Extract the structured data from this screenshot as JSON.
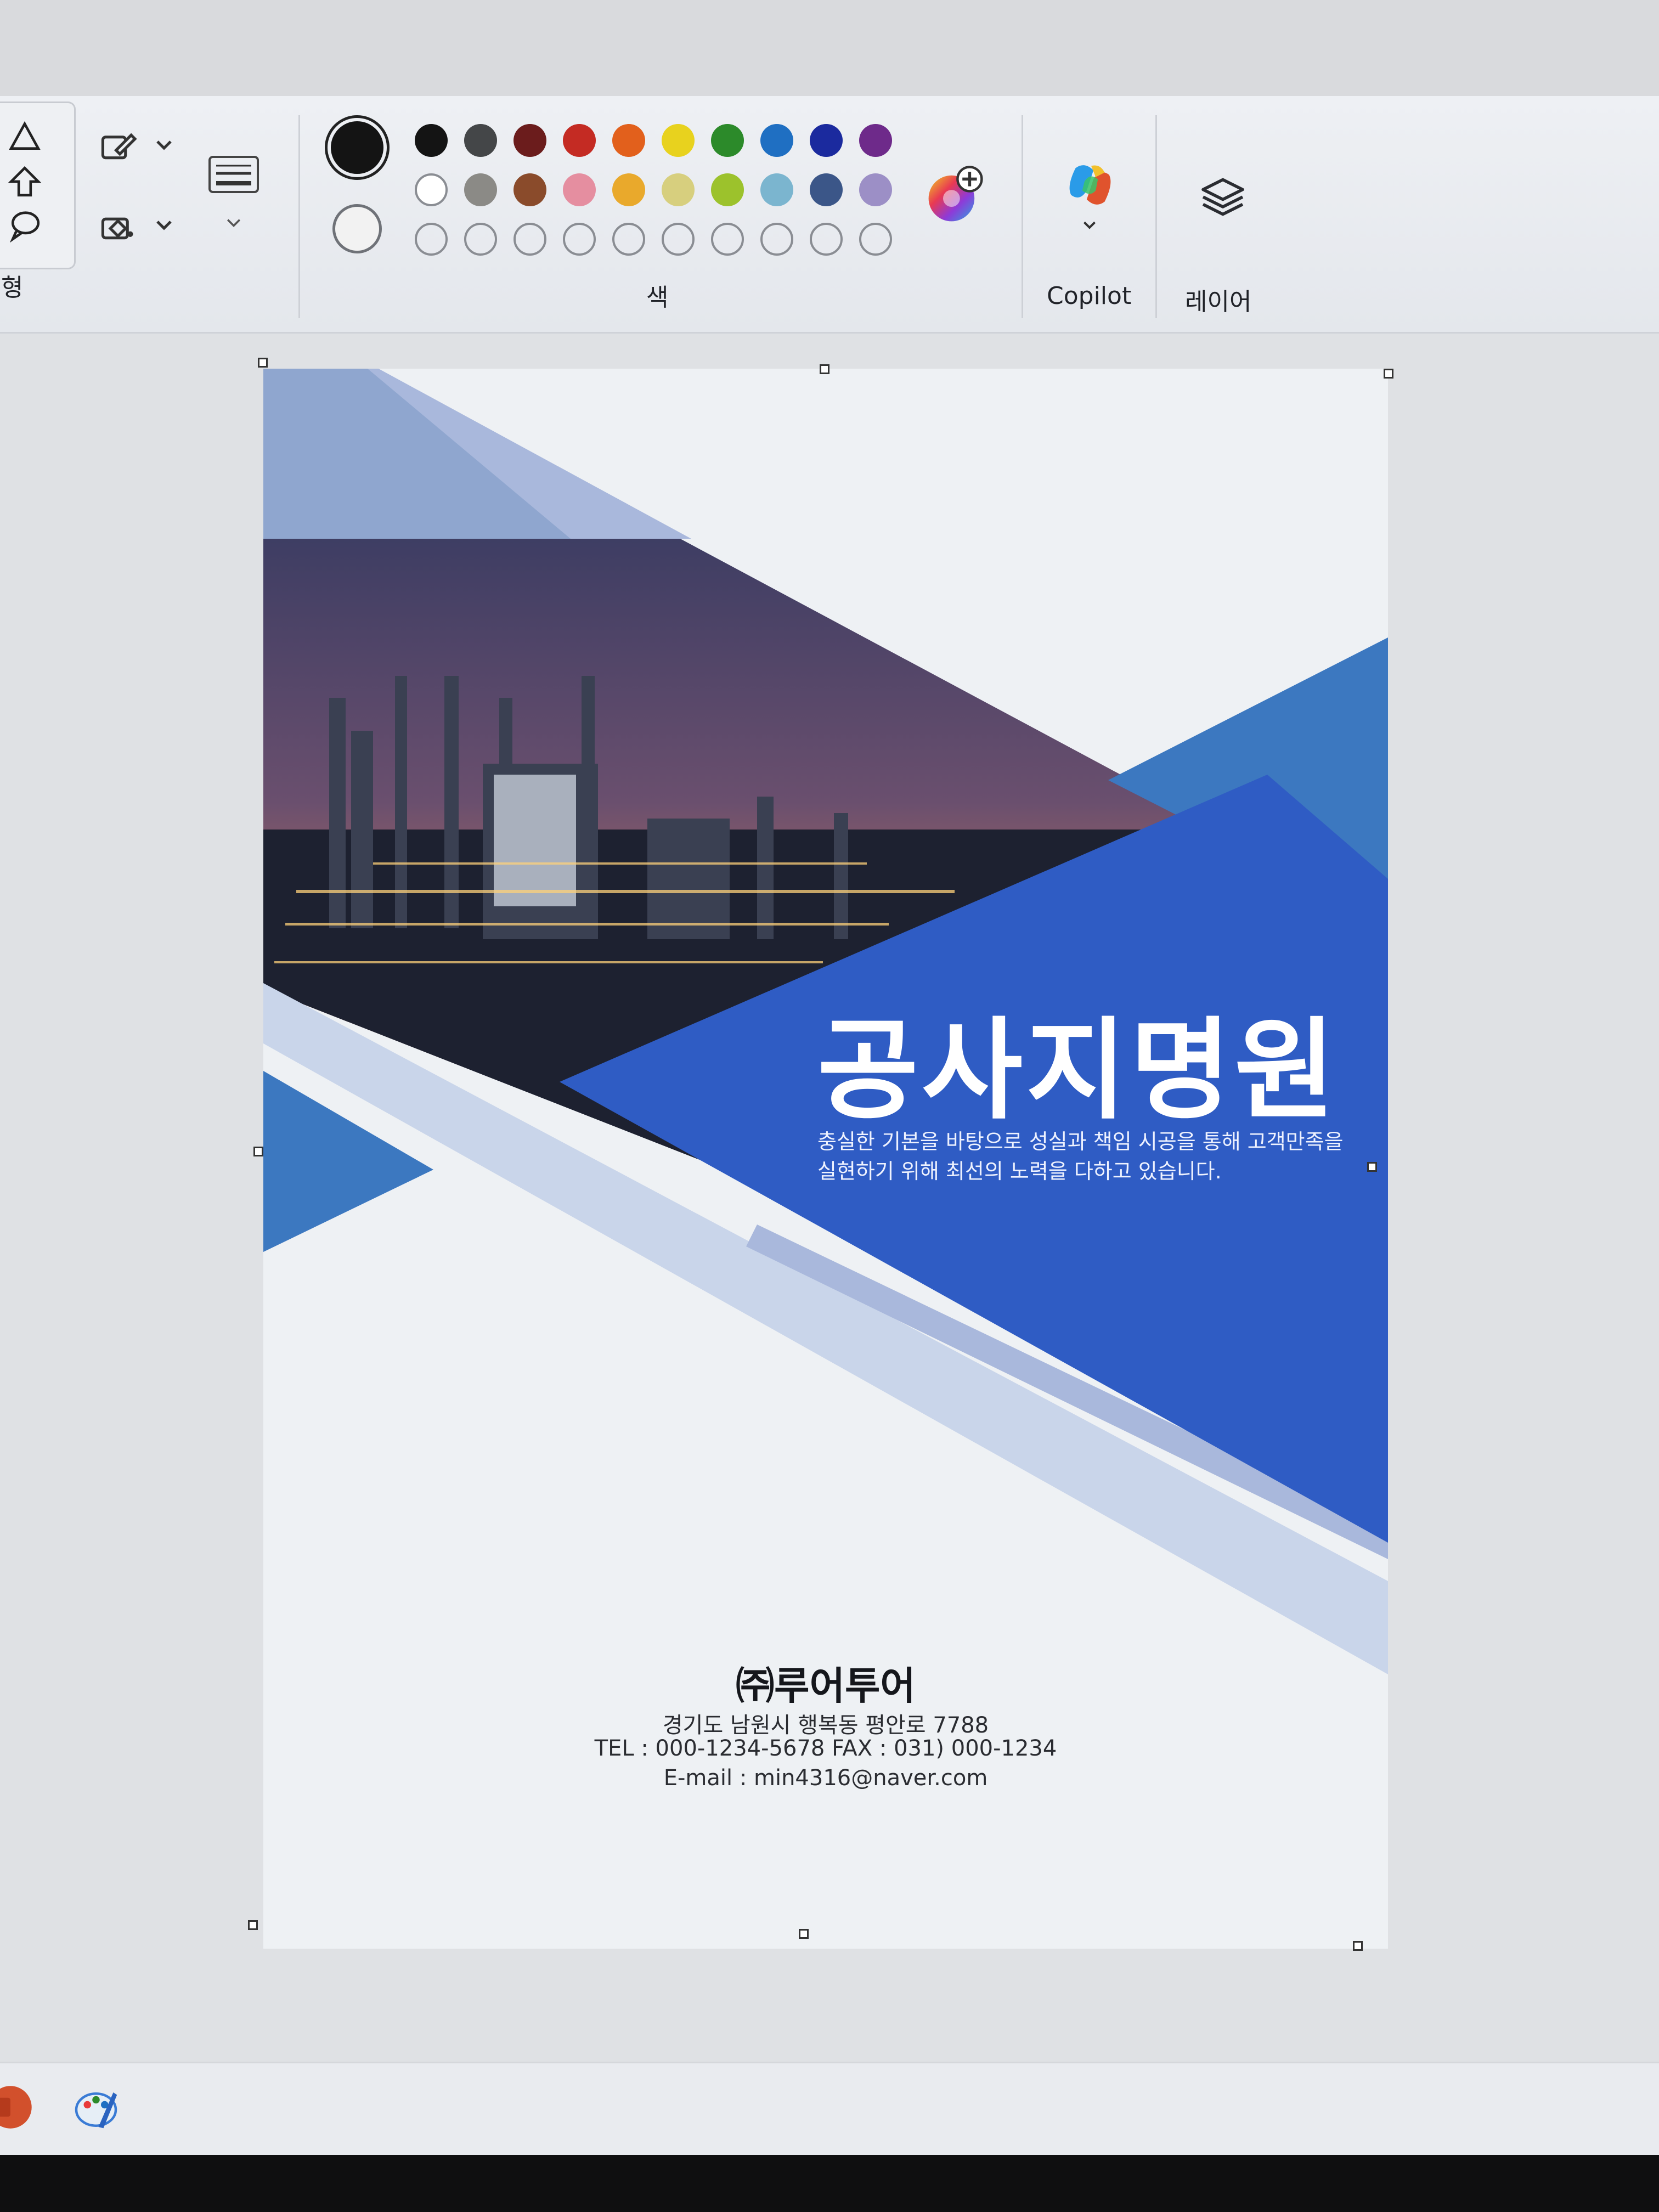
{
  "ribbon": {
    "shapes_group_label_partial": "형",
    "colors_group_label": "색",
    "copilot_label": "Copilot",
    "layers_label": "레이어",
    "shape_icons": [
      "triangle-icon",
      "arrow-up-icon",
      "speech-bubble-icon"
    ],
    "outline_icon": "pencil-outline-icon",
    "fill_icon": "fill-bucket-icon",
    "size_icon": "line-size-icon",
    "color1": "#141414",
    "color2": "#f2f2f2",
    "palette": [
      [
        "#141414",
        "#444648",
        "#6b1c1c",
        "#c42b23",
        "#e2601c",
        "#e8d21e",
        "#2c8a2a",
        "#1f6fc2",
        "#1b2a9e",
        "#6e2a8a"
      ],
      [
        "#ffffff",
        "#8b8a86",
        "#8a4b2b",
        "#e58ea0",
        "#e9a92c",
        "#d7cf7e",
        "#9cc22c",
        "#7bb5cf",
        "#3b5688",
        "#9c8fc6"
      ]
    ],
    "custom_slots": 10
  },
  "document": {
    "title": "공사지명원",
    "description_line1": "충실한 기본을 바탕으로 성실과 책임 시공을 통해 고객만족을",
    "description_line2": "실현하기 위해  최선의 노력을 다하고 있습니다.",
    "company": "㈜루어투어",
    "address": "경기도 남원시 행복동 평안로 7788",
    "tel_fax": "TEL : 000-1234-5678  FAX : 031) 000-1234",
    "email": "E-mail : min4316@naver.com",
    "colors": {
      "primary_blue": "#2f5cc4",
      "mid_blue": "#3c78c0",
      "light_blue": "#c9d5ea",
      "pale_blue": "#a9b8dc"
    }
  }
}
